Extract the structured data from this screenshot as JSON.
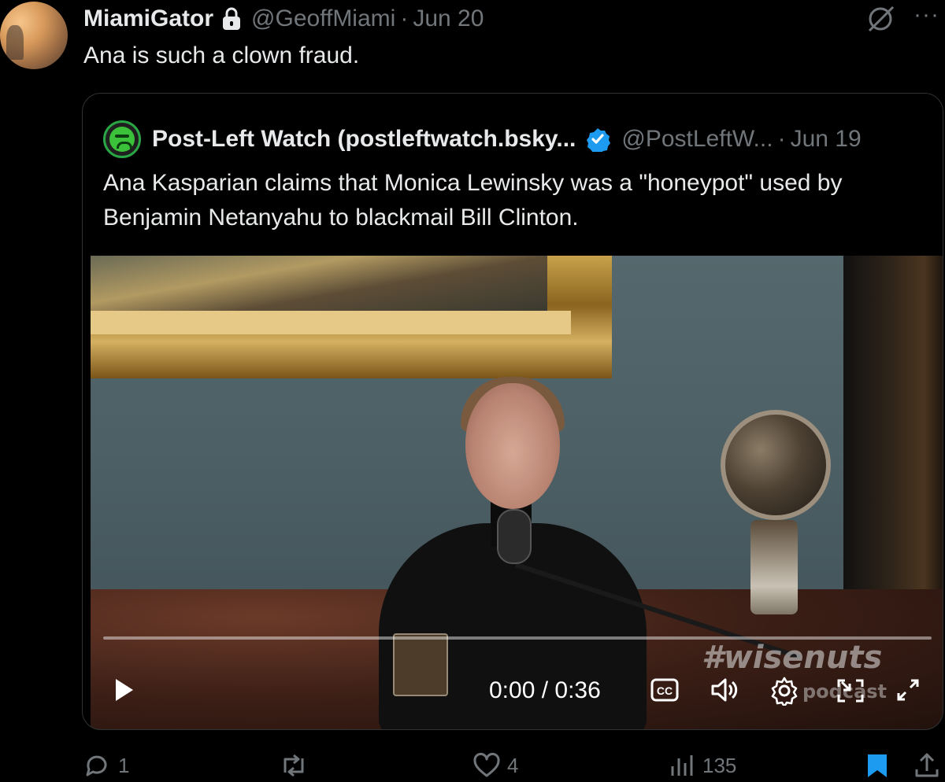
{
  "tweet": {
    "author_name": "MiamiGator",
    "author_handle": "@GeoffMiami",
    "separator": "·",
    "date": "Jun 20",
    "text": "Ana is such a clown fraud."
  },
  "quote": {
    "author_name": "Post-Left Watch (postleftwatch.bsky...",
    "author_handle": "@PostLeftW...",
    "separator": "·",
    "date": "Jun 19",
    "text": "Ana Kasparian claims that Monica Lewinsky was a \"honeypot\" used by Benjamin Netanyahu to blackmail Bill Clinton."
  },
  "video": {
    "time_display": "0:00 / 0:36",
    "watermark": "#wisenuts",
    "watermark_sub": "podcast",
    "progress": 0
  },
  "actions": {
    "replies": "1",
    "reposts": "",
    "likes": "4",
    "views": "135"
  },
  "colors": {
    "background": "#000000",
    "text_primary": "#e7e9ea",
    "text_secondary": "#71767b",
    "border": "#2f3336",
    "verified_blue": "#1d9bf0",
    "bookmark_blue": "#1d9bf0"
  },
  "icons": [
    "lock-icon",
    "grok-icon",
    "more-icon",
    "verified-icon",
    "play-icon",
    "captions-icon",
    "volume-icon",
    "settings-icon",
    "pip-icon",
    "fullscreen-icon",
    "reply-icon",
    "repost-icon",
    "like-icon",
    "views-icon",
    "bookmark-icon",
    "share-icon"
  ]
}
